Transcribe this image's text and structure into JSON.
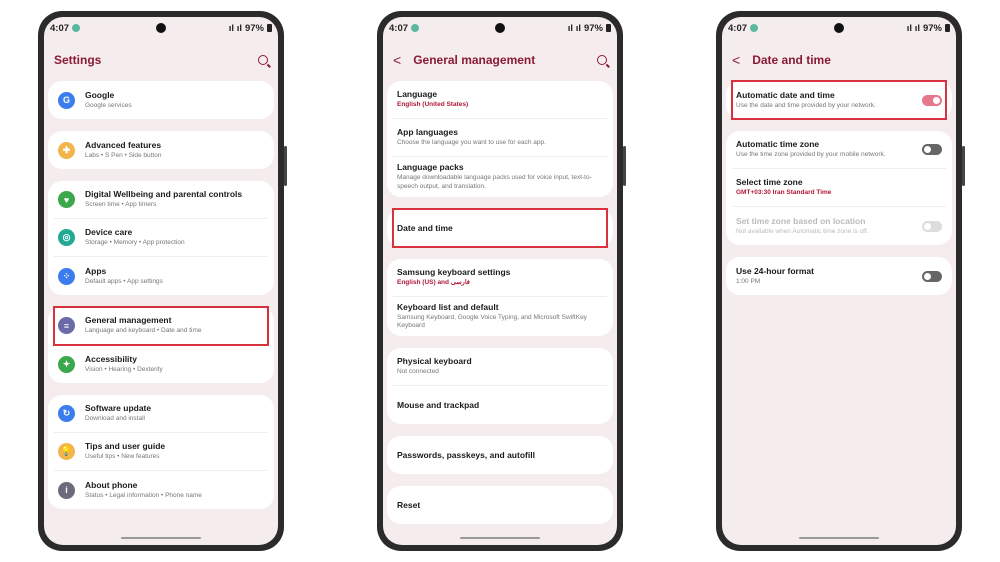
{
  "status": {
    "time": "4:07",
    "battery": "97%"
  },
  "screen1": {
    "title": "Settings",
    "groups": [
      [
        {
          "title": "Google",
          "sub": "Google services",
          "icon": "google-icon",
          "color": "#3b7ded",
          "glyph": "G"
        }
      ],
      [
        {
          "title": "Advanced features",
          "sub": "Labs  •  S Pen  •  Side button",
          "icon": "advanced-features-icon",
          "color": "#f1b54a",
          "glyph": "✚"
        }
      ],
      [
        {
          "title": "Digital Wellbeing and parental controls",
          "sub": "Screen time  •  App timers",
          "icon": "digital-wellbeing-icon",
          "color": "#3aa84b",
          "glyph": "♥"
        },
        {
          "title": "Device care",
          "sub": "Storage  •  Memory  •  App protection",
          "icon": "device-care-icon",
          "color": "#21a993",
          "glyph": "◎"
        },
        {
          "title": "Apps",
          "sub": "Default apps  •  App settings",
          "icon": "apps-icon",
          "color": "#3b7ded",
          "glyph": "⁘"
        }
      ],
      [
        {
          "title": "General management",
          "sub": "Language and keyboard  •  Date and time",
          "icon": "general-management-icon",
          "color": "#6a6aa8",
          "glyph": "≡",
          "highlight": true
        },
        {
          "title": "Accessibility",
          "sub": "Vision  •  Hearing  •  Dexterity",
          "icon": "accessibility-icon",
          "color": "#3aa84b",
          "glyph": "✦"
        }
      ],
      [
        {
          "title": "Software update",
          "sub": "Download and install",
          "icon": "software-update-icon",
          "color": "#3b7ded",
          "glyph": "↻"
        },
        {
          "title": "Tips and user guide",
          "sub": "Useful tips  •  New features",
          "icon": "tips-icon",
          "color": "#f1b54a",
          "glyph": "💡"
        },
        {
          "title": "About phone",
          "sub": "Status  •  Legal information  •  Phone name",
          "icon": "about-phone-icon",
          "color": "#6b6b7b",
          "glyph": "i"
        }
      ]
    ]
  },
  "screen2": {
    "title": "General management",
    "groups": [
      [
        {
          "title": "Language",
          "sub": "English (United States)",
          "subRed": true
        },
        {
          "title": "App languages",
          "sub": "Choose the language you want to use for each app."
        },
        {
          "title": "Language packs",
          "sub": "Manage downloadable language packs used for voice input, text-to-speech output, and translation."
        }
      ],
      [
        {
          "title": "Date and time",
          "highlight": true
        }
      ],
      [
        {
          "title": "Samsung keyboard settings",
          "sub": "English (US) and فارسی",
          "subRed": true
        },
        {
          "title": "Keyboard list and default",
          "sub": "Samsung Keyboard, Google Voice Typing, and Microsoft SwiftKey Keyboard"
        }
      ],
      [
        {
          "title": "Physical keyboard",
          "sub": "Not connected"
        },
        {
          "title": "Mouse and trackpad"
        }
      ],
      [
        {
          "title": "Passwords, passkeys, and autofill"
        }
      ],
      [
        {
          "title": "Reset"
        }
      ]
    ]
  },
  "screen3": {
    "title": "Date and time",
    "groups": [
      [
        {
          "title": "Automatic date and time",
          "sub": "Use the date and time provided by your network.",
          "toggle": "on",
          "highlight": true
        }
      ],
      [
        {
          "title": "Automatic time zone",
          "sub": "Use the time zone provided by your mobile network.",
          "toggle": "off"
        },
        {
          "title": "Select time zone",
          "sub": "GMT+03:30 Iran Standard Time",
          "subRed": true
        },
        {
          "title": "Set time zone based on location",
          "sub": "Not available when Automatic time zone is off.",
          "toggle": "disabled",
          "disabled": true
        }
      ],
      [
        {
          "title": "Use 24-hour format",
          "sub": "1:00 PM",
          "toggle": "off"
        }
      ]
    ]
  }
}
